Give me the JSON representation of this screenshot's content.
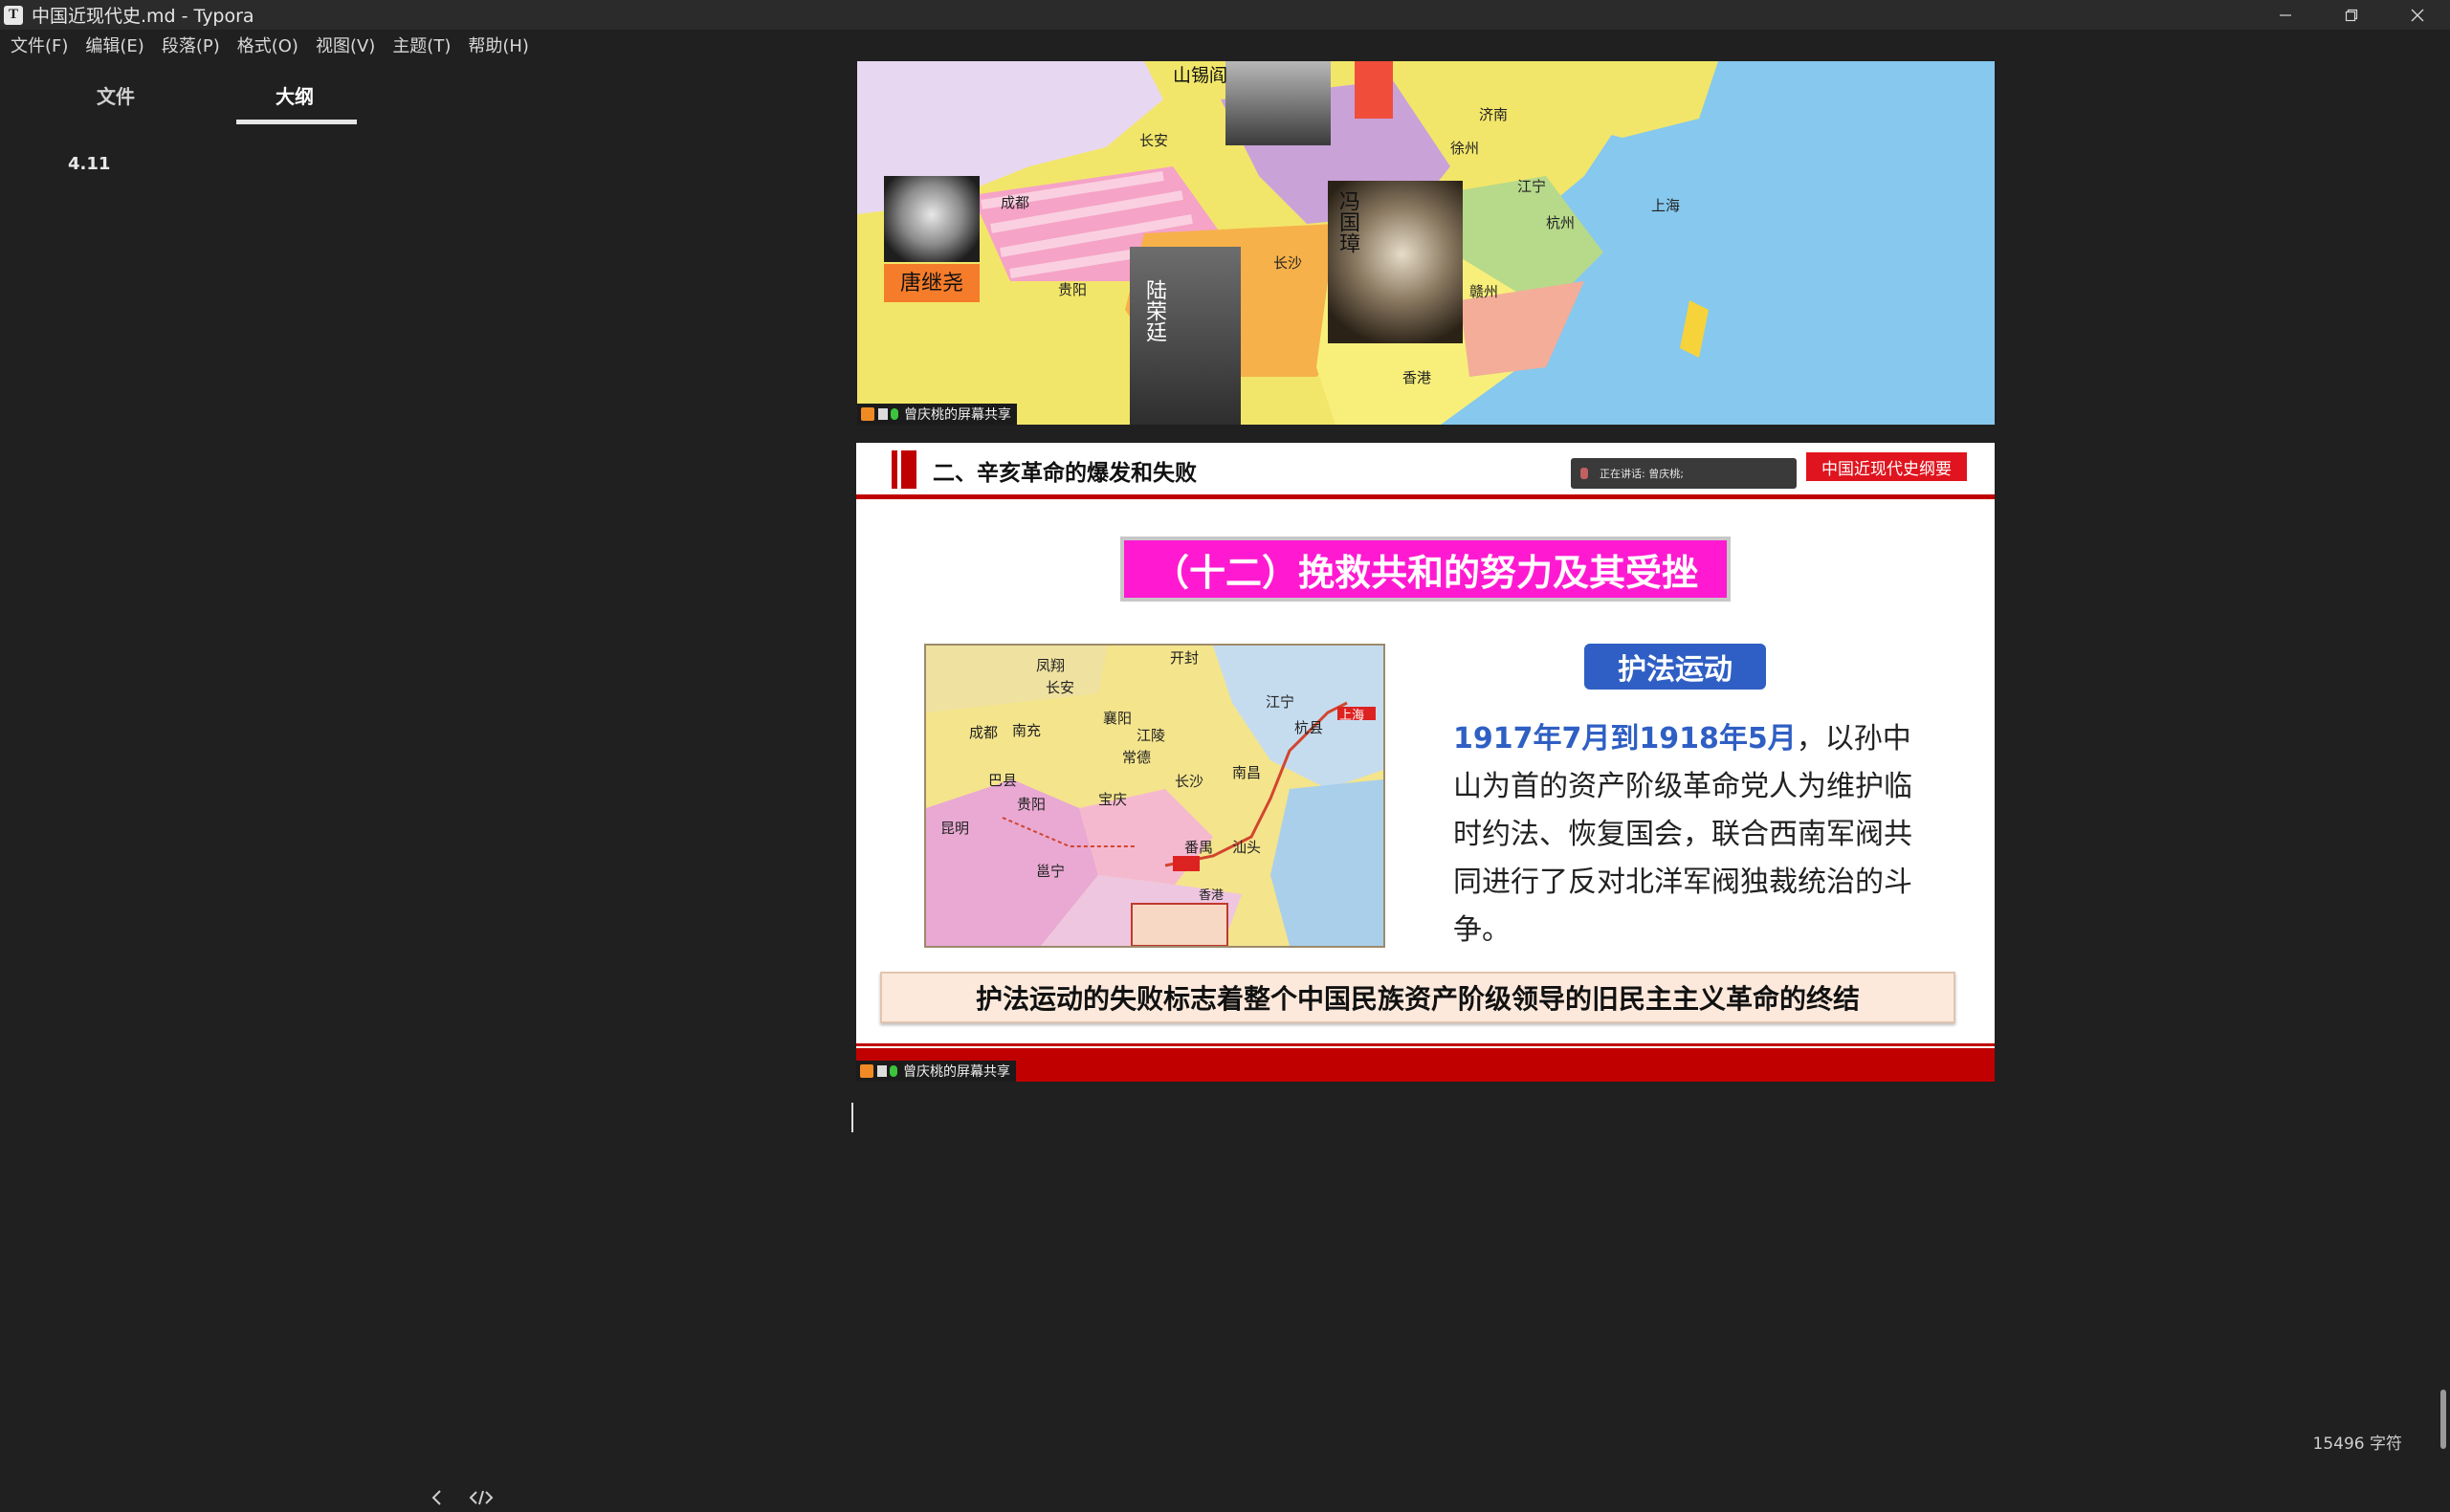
{
  "window": {
    "title": "中国近现代史.md - Typora",
    "app_icon_letter": "T"
  },
  "menu": [
    "文件(F)",
    "编辑(E)",
    "段落(P)",
    "格式(O)",
    "视图(V)",
    "主题(T)",
    "帮助(H)"
  ],
  "sidebar": {
    "tabs": [
      {
        "label": "文件",
        "active": false
      },
      {
        "label": "大纲",
        "active": true
      }
    ],
    "outline_items": [
      "4.11"
    ]
  },
  "image1": {
    "labels": {
      "tang": "唐继尧",
      "lu": "陆荣廷",
      "feng": "冯国璋",
      "shan": "山锡阎"
    },
    "cities": [
      "成都",
      "长安",
      "长沙",
      "贵阳",
      "济南",
      "上海",
      "杭州",
      "徐州",
      "江宁",
      "赣州",
      "香港"
    ],
    "share_tag": "曾庆桃的屏幕共享"
  },
  "slide": {
    "section_title": "二、辛亥革命的爆发和失败",
    "speaker": "正在讲话: 曾庆桃;",
    "course_tag": "中国近现代史纲要",
    "title": "（十二）挽救共和的努力及其受挫",
    "badge": "护法运动",
    "body_highlight": "1917年7月到1918年5月",
    "body_text": "，以孙中山为首的资产阶级革命党人为维护临时约法、恢复国会，联合西南军阀共同进行了反对北洋军阀独裁统治的斗争。",
    "map_cities": [
      "凤翔",
      "长安",
      "开封",
      "襄阳",
      "江陵",
      "成都",
      "南充",
      "巴县",
      "常德",
      "长沙",
      "南昌",
      "宝庆",
      "贵阳",
      "昆明",
      "邕宁",
      "番禺",
      "汕头",
      "江宁",
      "杭县",
      "上海",
      "香港"
    ],
    "bottom_note": "护法运动的失败标志着整个中国民族资产阶级领导的旧民主主义革命的终结",
    "share_tag": "曾庆桃的屏幕共享"
  },
  "status": {
    "word_count": "15496 字符"
  },
  "colors": {
    "background": "#202020",
    "slide_red": "#c00000",
    "title_magenta": "#ff1ad1",
    "badge_blue": "#2f5fc4"
  }
}
